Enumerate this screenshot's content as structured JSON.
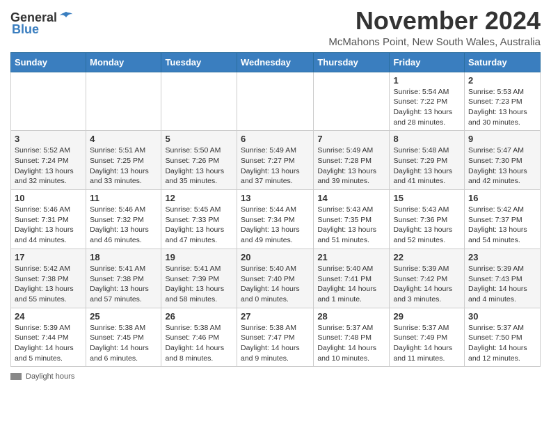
{
  "header": {
    "logo_general": "General",
    "logo_blue": "Blue",
    "month_title": "November 2024",
    "subtitle": "McMahons Point, New South Wales, Australia"
  },
  "days_of_week": [
    "Sunday",
    "Monday",
    "Tuesday",
    "Wednesday",
    "Thursday",
    "Friday",
    "Saturday"
  ],
  "weeks": [
    [
      {
        "day": "",
        "info": ""
      },
      {
        "day": "",
        "info": ""
      },
      {
        "day": "",
        "info": ""
      },
      {
        "day": "",
        "info": ""
      },
      {
        "day": "",
        "info": ""
      },
      {
        "day": "1",
        "info": "Sunrise: 5:54 AM\nSunset: 7:22 PM\nDaylight: 13 hours and 28 minutes."
      },
      {
        "day": "2",
        "info": "Sunrise: 5:53 AM\nSunset: 7:23 PM\nDaylight: 13 hours and 30 minutes."
      }
    ],
    [
      {
        "day": "3",
        "info": "Sunrise: 5:52 AM\nSunset: 7:24 PM\nDaylight: 13 hours and 32 minutes."
      },
      {
        "day": "4",
        "info": "Sunrise: 5:51 AM\nSunset: 7:25 PM\nDaylight: 13 hours and 33 minutes."
      },
      {
        "day": "5",
        "info": "Sunrise: 5:50 AM\nSunset: 7:26 PM\nDaylight: 13 hours and 35 minutes."
      },
      {
        "day": "6",
        "info": "Sunrise: 5:49 AM\nSunset: 7:27 PM\nDaylight: 13 hours and 37 minutes."
      },
      {
        "day": "7",
        "info": "Sunrise: 5:49 AM\nSunset: 7:28 PM\nDaylight: 13 hours and 39 minutes."
      },
      {
        "day": "8",
        "info": "Sunrise: 5:48 AM\nSunset: 7:29 PM\nDaylight: 13 hours and 41 minutes."
      },
      {
        "day": "9",
        "info": "Sunrise: 5:47 AM\nSunset: 7:30 PM\nDaylight: 13 hours and 42 minutes."
      }
    ],
    [
      {
        "day": "10",
        "info": "Sunrise: 5:46 AM\nSunset: 7:31 PM\nDaylight: 13 hours and 44 minutes."
      },
      {
        "day": "11",
        "info": "Sunrise: 5:46 AM\nSunset: 7:32 PM\nDaylight: 13 hours and 46 minutes."
      },
      {
        "day": "12",
        "info": "Sunrise: 5:45 AM\nSunset: 7:33 PM\nDaylight: 13 hours and 47 minutes."
      },
      {
        "day": "13",
        "info": "Sunrise: 5:44 AM\nSunset: 7:34 PM\nDaylight: 13 hours and 49 minutes."
      },
      {
        "day": "14",
        "info": "Sunrise: 5:43 AM\nSunset: 7:35 PM\nDaylight: 13 hours and 51 minutes."
      },
      {
        "day": "15",
        "info": "Sunrise: 5:43 AM\nSunset: 7:36 PM\nDaylight: 13 hours and 52 minutes."
      },
      {
        "day": "16",
        "info": "Sunrise: 5:42 AM\nSunset: 7:37 PM\nDaylight: 13 hours and 54 minutes."
      }
    ],
    [
      {
        "day": "17",
        "info": "Sunrise: 5:42 AM\nSunset: 7:38 PM\nDaylight: 13 hours and 55 minutes."
      },
      {
        "day": "18",
        "info": "Sunrise: 5:41 AM\nSunset: 7:38 PM\nDaylight: 13 hours and 57 minutes."
      },
      {
        "day": "19",
        "info": "Sunrise: 5:41 AM\nSunset: 7:39 PM\nDaylight: 13 hours and 58 minutes."
      },
      {
        "day": "20",
        "info": "Sunrise: 5:40 AM\nSunset: 7:40 PM\nDaylight: 14 hours and 0 minutes."
      },
      {
        "day": "21",
        "info": "Sunrise: 5:40 AM\nSunset: 7:41 PM\nDaylight: 14 hours and 1 minute."
      },
      {
        "day": "22",
        "info": "Sunrise: 5:39 AM\nSunset: 7:42 PM\nDaylight: 14 hours and 3 minutes."
      },
      {
        "day": "23",
        "info": "Sunrise: 5:39 AM\nSunset: 7:43 PM\nDaylight: 14 hours and 4 minutes."
      }
    ],
    [
      {
        "day": "24",
        "info": "Sunrise: 5:39 AM\nSunset: 7:44 PM\nDaylight: 14 hours and 5 minutes."
      },
      {
        "day": "25",
        "info": "Sunrise: 5:38 AM\nSunset: 7:45 PM\nDaylight: 14 hours and 6 minutes."
      },
      {
        "day": "26",
        "info": "Sunrise: 5:38 AM\nSunset: 7:46 PM\nDaylight: 14 hours and 8 minutes."
      },
      {
        "day": "27",
        "info": "Sunrise: 5:38 AM\nSunset: 7:47 PM\nDaylight: 14 hours and 9 minutes."
      },
      {
        "day": "28",
        "info": "Sunrise: 5:37 AM\nSunset: 7:48 PM\nDaylight: 14 hours and 10 minutes."
      },
      {
        "day": "29",
        "info": "Sunrise: 5:37 AM\nSunset: 7:49 PM\nDaylight: 14 hours and 11 minutes."
      },
      {
        "day": "30",
        "info": "Sunrise: 5:37 AM\nSunset: 7:50 PM\nDaylight: 14 hours and 12 minutes."
      }
    ]
  ],
  "footer": {
    "legend_label": "Daylight hours"
  }
}
